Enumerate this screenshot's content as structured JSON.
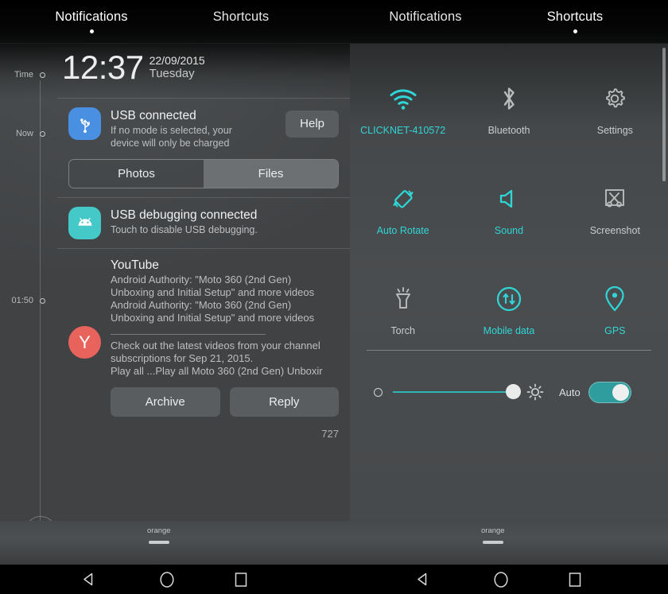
{
  "tabs": [
    {
      "label": "Notifications",
      "active": true,
      "pane": "left"
    },
    {
      "label": "Shortcuts",
      "active": false,
      "pane": "left"
    },
    {
      "label": "Notifications",
      "active": false,
      "pane": "right"
    },
    {
      "label": "Shortcuts",
      "active": true,
      "pane": "right"
    }
  ],
  "clock": {
    "time": "12:37",
    "date": "22/09/2015",
    "day": "Tuesday"
  },
  "timeline": {
    "marks": [
      {
        "label": "Time"
      },
      {
        "label": "Now"
      },
      {
        "label": "01:50"
      }
    ],
    "clear_all_icon": "trash-icon"
  },
  "notifications": [
    {
      "id": "usb-connected",
      "icon": "usb-icon",
      "title": "USB connected",
      "text_line1": "If no mode is selected, your",
      "text_line2": "device will only be charged",
      "action_label": "Help",
      "modes": [
        {
          "label": "Photos",
          "selected": false
        },
        {
          "label": "Files",
          "selected": true
        }
      ]
    },
    {
      "id": "usb-debugging",
      "icon": "android-icon",
      "title": "USB debugging connected",
      "text_line1": "Touch to disable USB debugging."
    },
    {
      "id": "youtube",
      "icon": "youtube-avatar",
      "avatar_letter": "Y",
      "title": "YouTube",
      "lines": [
        "Android Authority: \"Moto 360 (2nd Gen)",
        "Unboxing and Initial Setup\" and more videos",
        "Android Authority: \"Moto 360 (2nd Gen)",
        "Unboxing and Initial Setup\" and more videos"
      ],
      "body_lines": [
        "Check out the latest videos from your channel",
        "subscriptions for Sep 21, 2015.",
        "Play all  ...Play all   Moto 360 (2nd Gen) Unboxir"
      ],
      "actions": [
        {
          "label": "Archive"
        },
        {
          "label": "Reply"
        }
      ],
      "count": "727"
    }
  ],
  "quick_settings": {
    "tiles": [
      {
        "icon": "wifi-icon",
        "label": "CLICKNET-410572",
        "active": true
      },
      {
        "icon": "bluetooth-icon",
        "label": "Bluetooth",
        "active": false
      },
      {
        "icon": "gear-icon",
        "label": "Settings",
        "active": false
      },
      {
        "icon": "auto-rotate-icon",
        "label": "Auto Rotate",
        "active": true
      },
      {
        "icon": "sound-icon",
        "label": "Sound",
        "active": true
      },
      {
        "icon": "screenshot-icon",
        "label": "Screenshot",
        "active": false
      },
      {
        "icon": "torch-icon",
        "label": "Torch",
        "active": false
      },
      {
        "icon": "mobile-data-icon",
        "label": "Mobile data",
        "active": true
      },
      {
        "icon": "gps-icon",
        "label": "GPS",
        "active": true
      }
    ],
    "brightness": {
      "low_icon": "brightness-low-icon",
      "high_icon": "brightness-high-icon",
      "value_percent": 93,
      "auto_label": "Auto",
      "auto_on": true
    }
  },
  "carriers": [
    {
      "name": "orange"
    },
    {
      "name": "orange"
    }
  ],
  "navbar": {
    "buttons": [
      {
        "icon": "back-icon"
      },
      {
        "icon": "home-icon"
      },
      {
        "icon": "recents-icon"
      }
    ]
  },
  "colors": {
    "accent_teal": "#2fd6d6",
    "inactive_gray": "#c9cbcc",
    "panel_bg": "#45484a",
    "usb_blue": "#4a90e2",
    "adb_teal": "#44c8c8",
    "youtube_red": "#e8635c"
  }
}
